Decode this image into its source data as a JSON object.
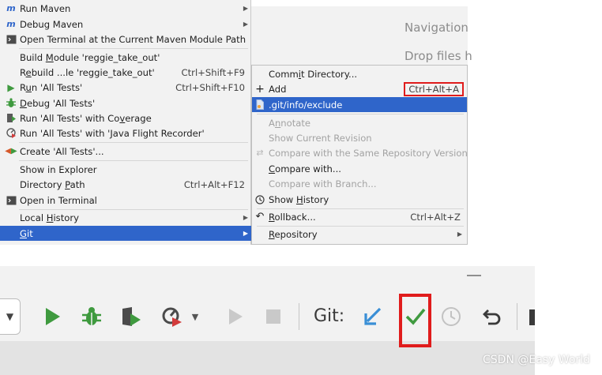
{
  "editor_hints": {
    "navigation": "Navigation",
    "drop_files": "Drop files h"
  },
  "context_menu": {
    "run_maven": "Run Maven",
    "debug_maven": "Debug Maven",
    "open_terminal_maven": "Open Terminal at the Current Maven Module Path",
    "build_module": {
      "pre": "Build ",
      "u": "M",
      "post": "odule 'reggie_take_out'"
    },
    "rebuild": {
      "pre": "R",
      "u": "e",
      "post": "build ...le 'reggie_take_out'",
      "shortcut": "Ctrl+Shift+F9"
    },
    "run_tests": {
      "pre": "R",
      "u": "u",
      "post": "n 'All Tests'",
      "shortcut": "Ctrl+Shift+F10"
    },
    "debug_tests": {
      "pre": "",
      "u": "D",
      "post": "ebug 'All Tests'"
    },
    "run_coverage": {
      "pre": "Run 'All Tests' with Co",
      "u": "v",
      "post": "erage"
    },
    "run_jfr": "Run 'All Tests' with 'Java Flight Recorder'",
    "create_tests": "Create 'All Tests'...",
    "show_explorer": "Show in Explorer",
    "directory_path": {
      "pre": "Directory ",
      "u": "P",
      "post": "ath",
      "shortcut": "Ctrl+Alt+F12"
    },
    "open_terminal": "Open in Terminal",
    "local_history": {
      "pre": "Local ",
      "u": "H",
      "post": "istory"
    },
    "git": {
      "pre": "",
      "u": "G",
      "post": "it"
    }
  },
  "git_menu": {
    "commit_directory": {
      "pre": "Comm",
      "u": "i",
      "post": "t Directory..."
    },
    "add": "Add",
    "add_shortcut": "Ctrl+Alt+A",
    "exclude": ".git/info/exclude",
    "annotate": {
      "pre": "A",
      "u": "n",
      "post": "notate"
    },
    "show_current_revision": "Show Current Revision",
    "compare_same_repo": "Compare with the Same Repository Version",
    "compare_with": {
      "pre": "",
      "u": "C",
      "post": "ompare with..."
    },
    "compare_branch": "Compare with Branch...",
    "show_history": {
      "pre": "Show ",
      "u": "H",
      "post": "istory"
    },
    "rollback": {
      "pre": "",
      "u": "R",
      "post": "ollback..."
    },
    "rollback_shortcut": "Ctrl+Alt+Z",
    "repository": {
      "pre": "",
      "u": "R",
      "post": "epository"
    }
  },
  "toolbar": {
    "git_label": "Git:"
  },
  "watermark": "CSDN @Easy World",
  "colors": {
    "selection": "#2f65ca",
    "highlight_box": "#e01c1c",
    "run_green": "#3f9a3f",
    "vcs_blue": "#3a8fd6"
  }
}
